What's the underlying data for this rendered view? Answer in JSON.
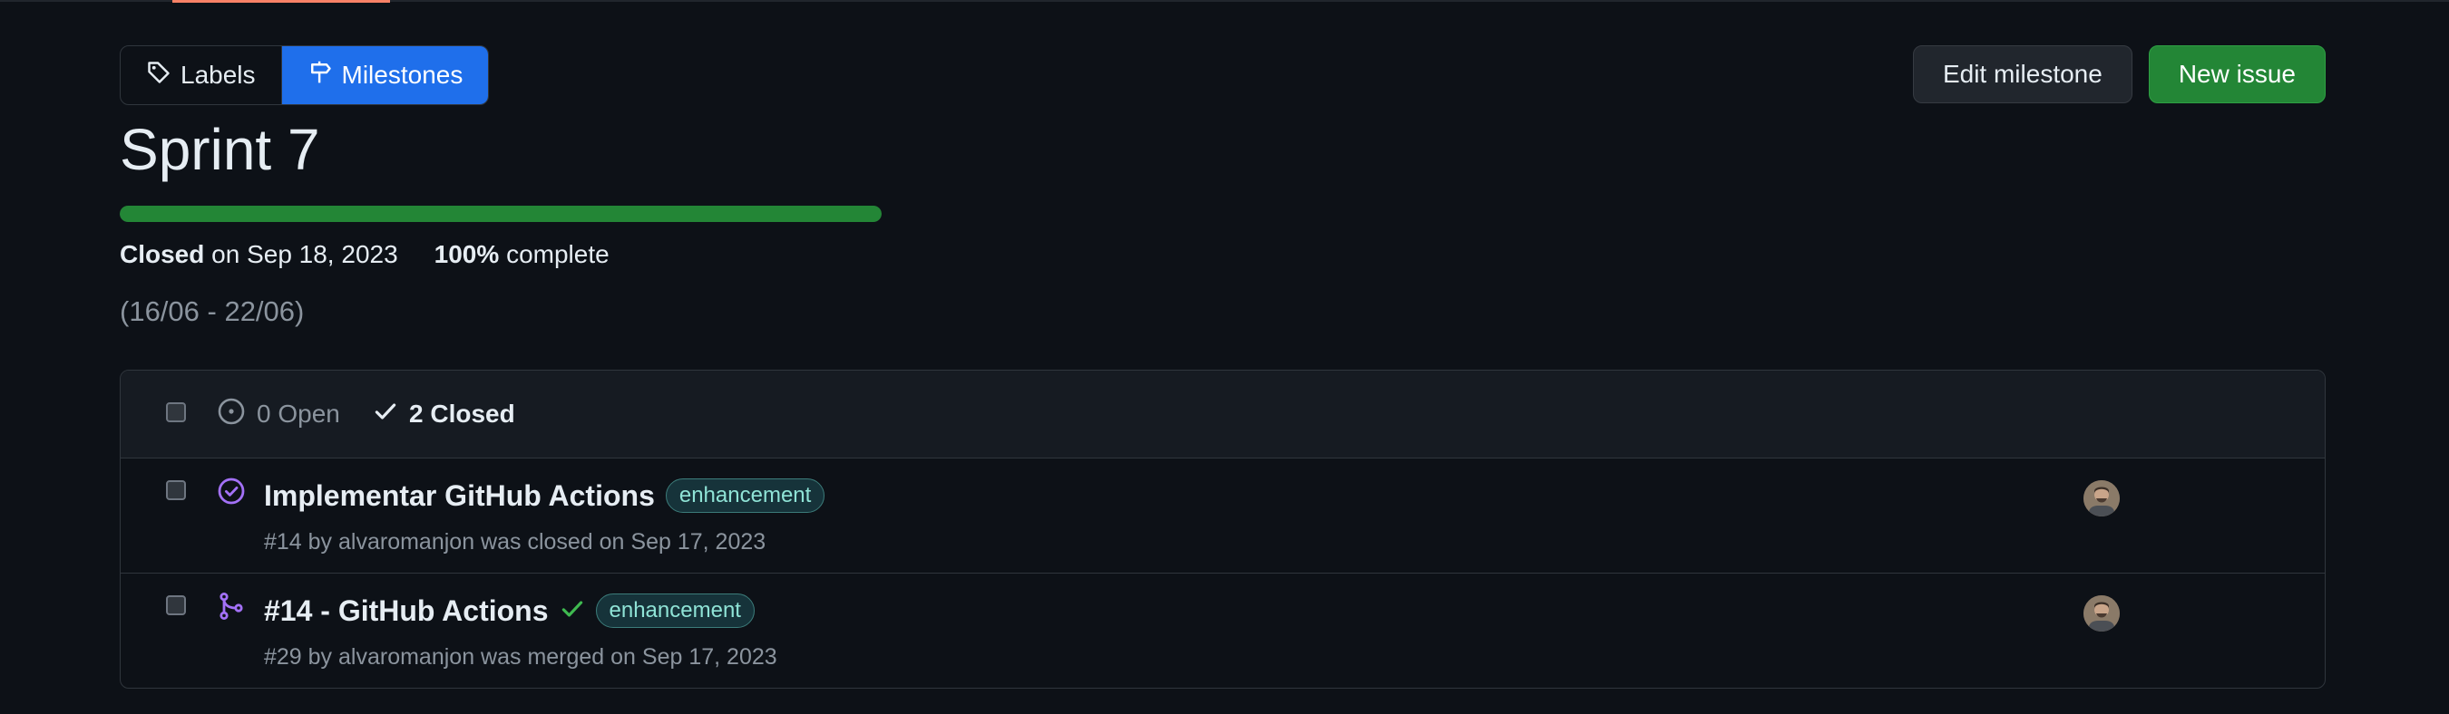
{
  "subnav": {
    "labels_label": "Labels",
    "milestones_label": "Milestones"
  },
  "actions": {
    "edit_label": "Edit milestone",
    "new_issue_label": "New issue"
  },
  "milestone": {
    "title": "Sprint 7",
    "progress_fraction": 1.0,
    "status_strong": "Closed",
    "status_date": "on Sep 18, 2023",
    "percent_strong": "100%",
    "percent_text": "complete",
    "description": "(16/06 - 22/06)"
  },
  "list_header": {
    "open_label": "0 Open",
    "closed_label": "2 Closed"
  },
  "items": [
    {
      "title": "Implementar GitHub Actions",
      "label": "enhancement",
      "meta": "#14 by alvaromanjon was closed on Sep 17, 2023",
      "icon": "issue-closed-icon"
    },
    {
      "title": "#14 - GitHub Actions",
      "label": "enhancement",
      "meta": "#29 by alvaromanjon was merged on Sep 17, 2023",
      "icon": "pull-request-merged-icon",
      "status_icon": "check-icon"
    }
  ],
  "colors": {
    "background": "#0d1117",
    "accent_blue": "#1f6feb",
    "success_green": "#238636",
    "merged_purple": "#a371f7",
    "label_teal": "#8fe3d6"
  }
}
